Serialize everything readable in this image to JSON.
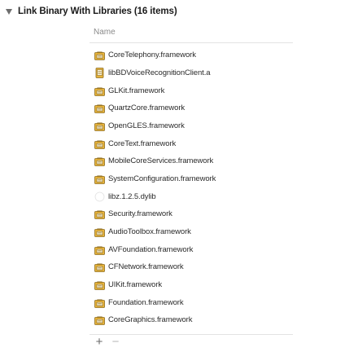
{
  "section": {
    "title": "Link Binary With Libraries (16 items)"
  },
  "table": {
    "column_header": "Name",
    "rows": [
      {
        "label": "CoreTelephony.framework",
        "icon": "framework-icon"
      },
      {
        "label": "libBDVoiceRecognitionClient.a",
        "icon": "static-library-icon"
      },
      {
        "label": "GLKit.framework",
        "icon": "framework-icon"
      },
      {
        "label": "QuartzCore.framework",
        "icon": "framework-icon"
      },
      {
        "label": "OpenGLES.framework",
        "icon": "framework-icon"
      },
      {
        "label": "CoreText.framework",
        "icon": "framework-icon"
      },
      {
        "label": "MobileCoreServices.framework",
        "icon": "framework-icon"
      },
      {
        "label": "SystemConfiguration.framework",
        "icon": "framework-icon"
      },
      {
        "label": "libz.1.2.5.dylib",
        "icon": "dylib-icon"
      },
      {
        "label": "Security.framework",
        "icon": "framework-icon"
      },
      {
        "label": "AudioToolbox.framework",
        "icon": "framework-icon"
      },
      {
        "label": "AVFoundation.framework",
        "icon": "framework-icon"
      },
      {
        "label": "CFNetwork.framework",
        "icon": "framework-icon"
      },
      {
        "label": "UIKit.framework",
        "icon": "framework-icon"
      },
      {
        "label": "Foundation.framework",
        "icon": "framework-icon"
      },
      {
        "label": "CoreGraphics.framework",
        "icon": "framework-icon"
      }
    ]
  },
  "controls": {
    "add": "+",
    "remove": "−"
  },
  "colors": {
    "framework_icon": "#e9b53c",
    "framework_icon_dark": "#8a6a1e"
  }
}
